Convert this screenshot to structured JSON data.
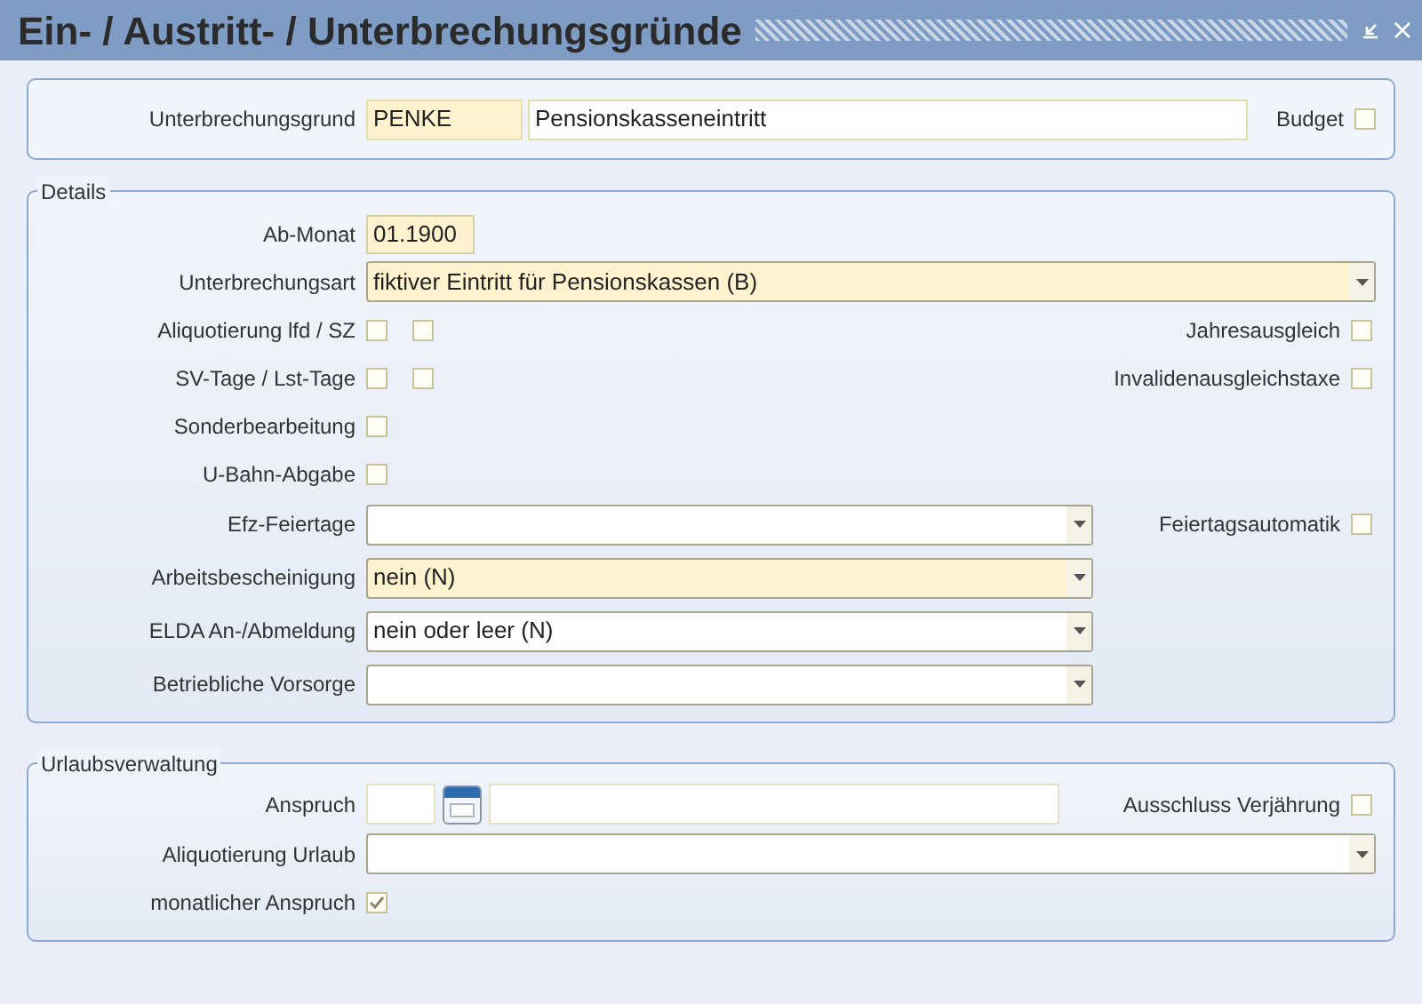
{
  "window": {
    "title": "Ein- / Austritt- / Unterbrechungsgründe"
  },
  "header": {
    "label": "Unterbrechungsgrund",
    "code": "PENKE",
    "code_required": true,
    "name": "Pensionskasseneintritt",
    "name_required": false,
    "budget": {
      "label": "Budget",
      "checked": false
    }
  },
  "details": {
    "legend": "Details",
    "rows": [
      {
        "kind": "text",
        "label": "Ab-Monat",
        "value": "01.1900",
        "required": true
      },
      {
        "kind": "select_wide",
        "label": "Unterbrechungsart",
        "value": "fiktiver Eintritt für Pensionskassen (B)",
        "required": true
      },
      {
        "kind": "checks",
        "label": "Aliquotierung lfd / SZ",
        "checks": [
          {
            "checked": false
          },
          {
            "checked": false
          }
        ],
        "right": {
          "label": "Jahresausgleich",
          "checked": false
        }
      },
      {
        "kind": "checks",
        "label": "SV-Tage / Lst-Tage",
        "checks": [
          {
            "checked": false
          },
          {
            "checked": false
          }
        ],
        "right": {
          "label": "Invalidenausgleichstaxe",
          "checked": false
        }
      },
      {
        "kind": "checks",
        "label": "Sonderbearbeitung",
        "checks": [
          {
            "checked": false
          }
        ]
      },
      {
        "kind": "checks",
        "label": "U-Bahn-Abgabe",
        "checks": [
          {
            "checked": false
          }
        ]
      },
      {
        "kind": "select",
        "label": "Efz-Feiertage",
        "required": false,
        "right": {
          "label": "Feiertagsautomatik",
          "checked": false
        }
      },
      {
        "kind": "select",
        "label": "Arbeitsbescheinigung",
        "value": "nein (N)",
        "required": true
      },
      {
        "kind": "select",
        "label": "ELDA An-/Abmeldung",
        "value": "nein oder leer (N)",
        "required": false
      },
      {
        "kind": "select",
        "label": "Betriebliche Vorsorge",
        "required": false
      }
    ]
  },
  "vacation": {
    "legend": "Urlaubsverwaltung",
    "rows": [
      {
        "kind": "date",
        "label": "Anspruch",
        "right": {
          "label": "Ausschluss Verjährung",
          "checked": false
        }
      },
      {
        "kind": "select_wide",
        "label": "Aliquotierung Urlaub",
        "required": false
      },
      {
        "kind": "checks",
        "label": "monatlicher Anspruch",
        "checks": [
          {
            "checked": true
          }
        ]
      }
    ]
  }
}
